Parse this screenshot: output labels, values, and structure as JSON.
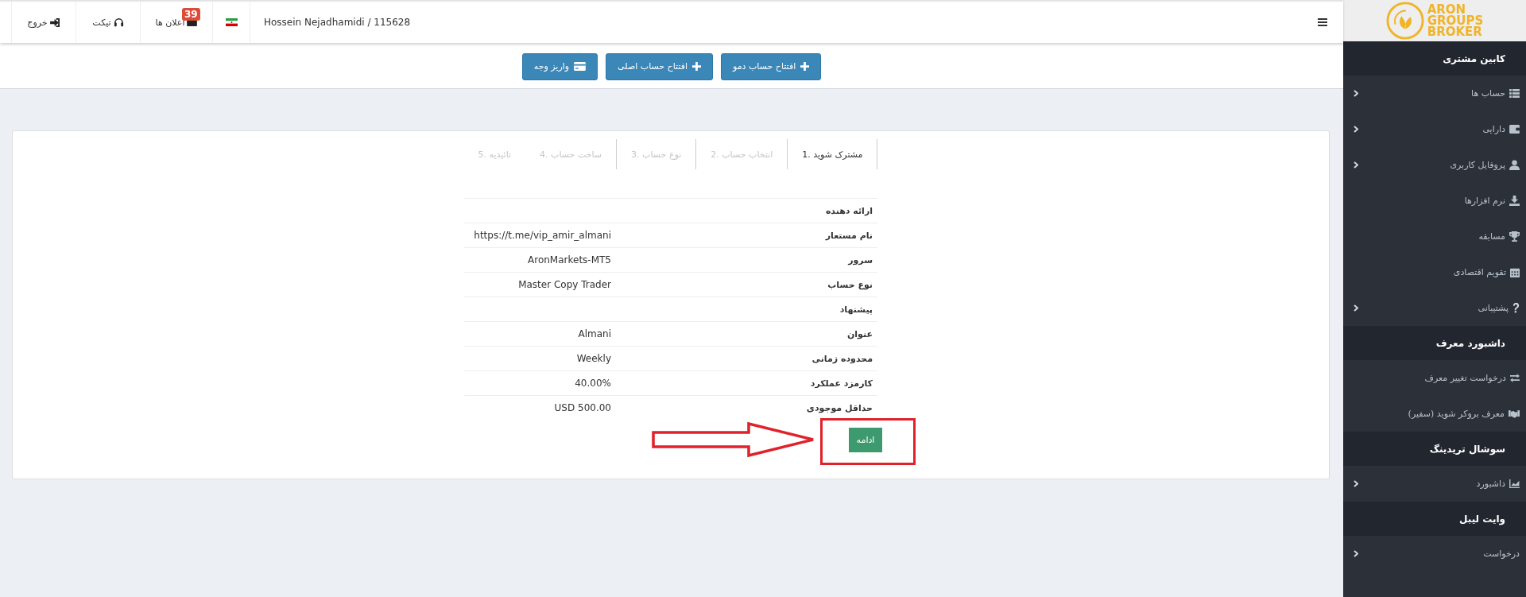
{
  "topbar": {
    "user": "Hossein Nejadhamidi / 115628",
    "announcements": {
      "label": "اعلان ها",
      "badge": "39"
    },
    "ticket": "تیکت",
    "logout": "خروج"
  },
  "actions": [
    {
      "label": "افتتاح حساب دمو",
      "kind": "plus"
    },
    {
      "label": "افتتاح حساب اصلی",
      "kind": "plus"
    },
    {
      "label": "واریز وجه",
      "kind": "card"
    }
  ],
  "steps": [
    {
      "label": "1. مشترک شوید",
      "selected": true
    },
    {
      "label": "2. انتخاب حساب",
      "selected": false
    },
    {
      "label": "3. نوع حساب",
      "selected": false
    },
    {
      "label": "4. ساخت حساب",
      "selected": false
    },
    {
      "label": "5. تائیدیه",
      "selected": false
    }
  ],
  "details": [
    {
      "label": "ارائه دهنده"
    },
    {
      "label": "نام مستعار",
      "value": "https://t.me/vip_amir_almani"
    },
    {
      "label": "سرور",
      "value": "AronMarkets-MT5"
    },
    {
      "label": "نوع حساب",
      "value": "Master Copy Trader"
    },
    {
      "label": "پیشنهاد"
    },
    {
      "label": "عنوان",
      "value": "Almani"
    },
    {
      "label": "محدوده زمانی",
      "value": "Weekly"
    },
    {
      "label": "کارمزد عملکرد",
      "value": "40.00%"
    },
    {
      "label": "حداقل موجودی",
      "value": "USD 500.00"
    }
  ],
  "continue_button": "ادامه",
  "sidebar": {
    "logo": [
      "ARON",
      "GROUPS",
      "BROKER"
    ],
    "sections": [
      {
        "title": "کابین مشتری",
        "items": [
          {
            "label": "حساب ها",
            "expandable": true
          },
          {
            "label": "دارایی",
            "expandable": true
          },
          {
            "label": "پروفایل کاربری",
            "expandable": true
          },
          {
            "label": "نرم افزارها",
            "expandable": false
          },
          {
            "label": "مسابقه",
            "expandable": false
          },
          {
            "label": "تقویم اقتصادی",
            "expandable": false
          },
          {
            "label": "پشتیبانی",
            "expandable": true
          }
        ]
      },
      {
        "title": "داشبورد معرف",
        "items": [
          {
            "label": "درخواست تغییر معرف",
            "expandable": false
          },
          {
            "label": "معرف بروکر شوید (سفیر)",
            "expandable": false
          }
        ]
      },
      {
        "title": "سوشال تریدینگ",
        "items": [
          {
            "label": "داشبورد",
            "expandable": true
          }
        ]
      },
      {
        "title": "وایت لیبل",
        "items": [
          {
            "label": "درخواست",
            "expandable": true
          }
        ]
      }
    ]
  }
}
